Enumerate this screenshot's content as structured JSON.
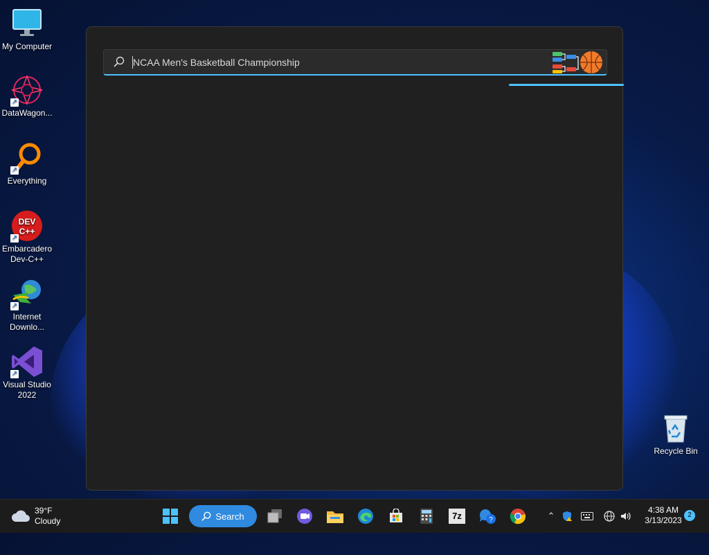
{
  "desktop": {
    "icons": [
      {
        "label": "My Computer"
      },
      {
        "label": "DataWagon..."
      },
      {
        "label": "Everything"
      },
      {
        "label": "Embarcadero Dev-C++"
      },
      {
        "label": "Internet Downlo..."
      },
      {
        "label": "Visual Studio 2022"
      }
    ],
    "recycle_bin": {
      "label": "Recycle Bin"
    }
  },
  "search_panel": {
    "query": "NCAA Men's Basketball Championship",
    "search_icon": "search-icon",
    "highlight_icon": "basketball-bracket-icon"
  },
  "taskbar": {
    "weather": {
      "temp": "39°F",
      "condition": "Cloudy",
      "icon": "cloud-icon"
    },
    "search_label": "Search",
    "apps": [
      "windows-start",
      "search",
      "task-view",
      "teams-chat",
      "file-explorer",
      "edge",
      "microsoft-store",
      "calculator",
      "7zip",
      "quick-assist",
      "chrome"
    ],
    "sevenzip_label": "7z",
    "clock": {
      "time": "4:38 AM",
      "date": "3/13/2023"
    },
    "notifications_count": "2"
  },
  "colors": {
    "accent": "#4cc2ff",
    "panel": "#202020",
    "taskbar": "#1c1c1c",
    "search_pill": "#2f8ae0"
  }
}
